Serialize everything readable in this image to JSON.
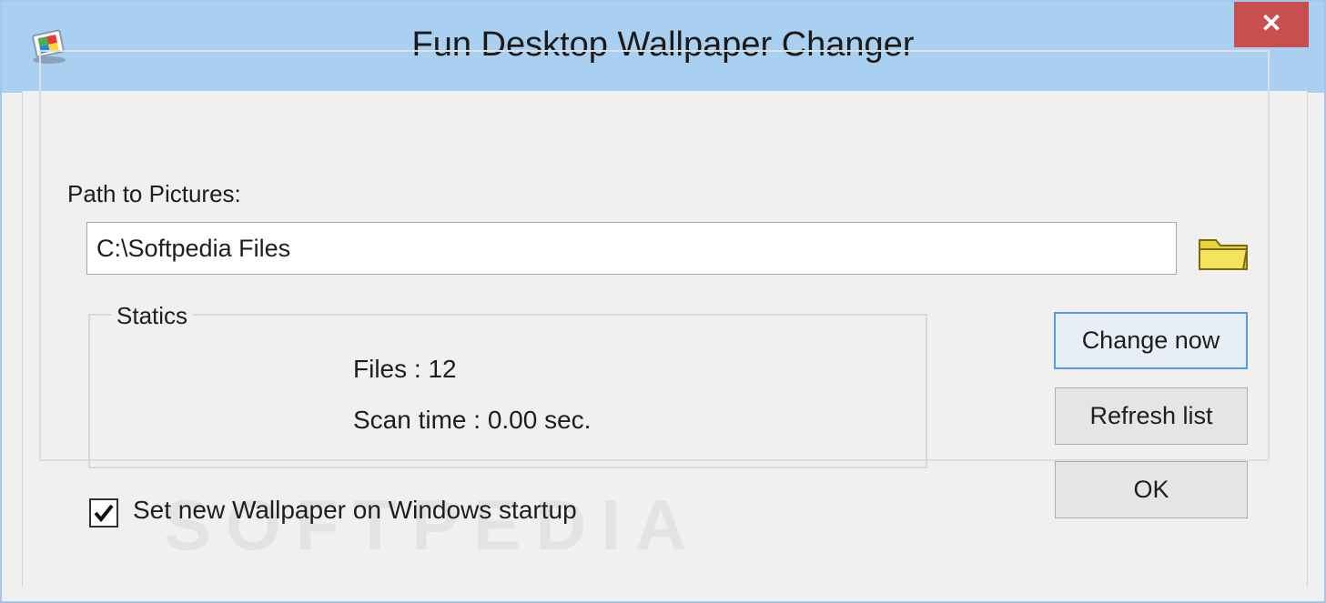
{
  "window": {
    "title": "Fun Desktop Wallpaper Changer",
    "close_label": "✕",
    "app_icon": "wallpaper-changer-app-icon"
  },
  "path": {
    "label": "Path to Pictures:",
    "value": "C:\\Softpedia Files",
    "browse_icon": "folder-icon"
  },
  "statics": {
    "legend": "Statics",
    "files": "Files : 12",
    "scan_time": "Scan time : 0.00 sec."
  },
  "buttons": {
    "change_now": "Change now",
    "refresh_list": "Refresh list",
    "ok": "OK"
  },
  "startup": {
    "checked": true,
    "label": "Set new Wallpaper on Windows startup"
  },
  "watermark": "SOFTPEDIA",
  "colors": {
    "titlebar": "#a9d0f0",
    "close_button": "#c84f4d",
    "window_bg": "#f0f0f0",
    "focus_border": "#5a9be0",
    "folder_yellow": "#e6d23a"
  }
}
